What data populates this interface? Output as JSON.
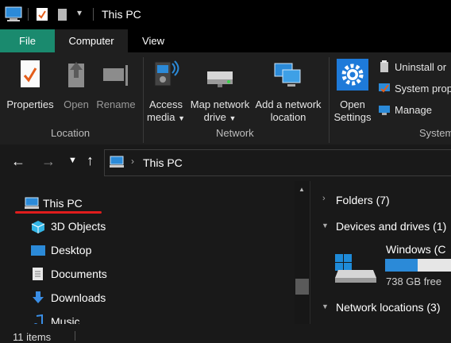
{
  "window": {
    "title": "This PC"
  },
  "tabs": [
    {
      "label": "File"
    },
    {
      "label": "Computer"
    },
    {
      "label": "View"
    }
  ],
  "ribbon": {
    "location": {
      "label": "Location",
      "buttons": [
        {
          "label": "Properties"
        },
        {
          "label": "Open"
        },
        {
          "label": "Rename"
        }
      ]
    },
    "network": {
      "label": "Network",
      "access_media": {
        "line1": "Access",
        "line2": "media"
      },
      "map_drive": {
        "line1": "Map network",
        "line2": "drive"
      },
      "add_location": {
        "line1": "Add a network",
        "line2": "location"
      }
    },
    "system": {
      "label": "System",
      "open_settings": {
        "line1": "Open",
        "line2": "Settings"
      },
      "items": [
        {
          "label": "Uninstall or"
        },
        {
          "label": "System prop"
        },
        {
          "label": "Manage"
        }
      ]
    }
  },
  "address": {
    "path": "This PC"
  },
  "nav": {
    "items": [
      {
        "label": "This PC"
      },
      {
        "label": "3D Objects"
      },
      {
        "label": "Desktop"
      },
      {
        "label": "Documents"
      },
      {
        "label": "Downloads"
      },
      {
        "label": "Music"
      }
    ]
  },
  "content": {
    "folders": "Folders (7)",
    "devices": "Devices and drives (1)",
    "drive_name": "Windows (C",
    "drive_free": "738 GB free",
    "drive_used_fraction": 0.45,
    "network": "Network locations (3)"
  },
  "status": {
    "items": "11 items"
  },
  "colors": {
    "file_tab": "#1a8a6e",
    "accent": "#2b8ad8",
    "annotation": "#e01d1d"
  }
}
